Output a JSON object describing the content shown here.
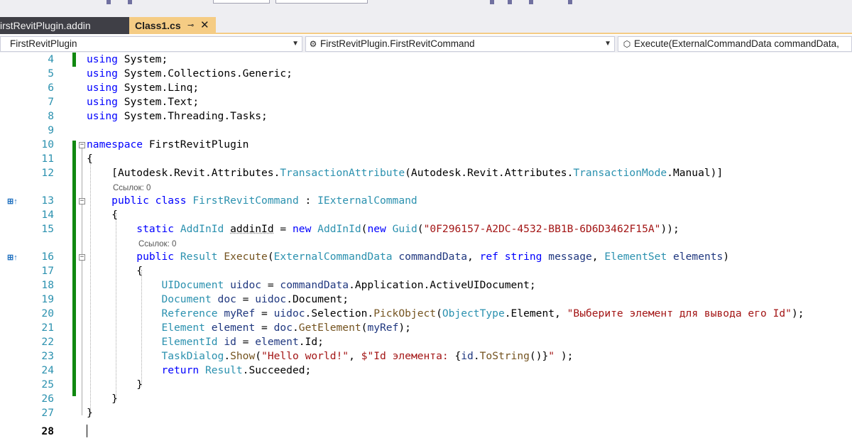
{
  "tabs": {
    "inactive_label": "irstRevitPlugin.addin",
    "active_label": "Class1.cs",
    "pin_icon": "⊸",
    "close_icon": "✕"
  },
  "nav": {
    "project": "FirstRevitPlugin",
    "class_icon": "⚙",
    "class": "FirstRevitPlugin.FirstRevitCommand",
    "member_icon": "⬡",
    "member": "Execute(ExternalCommandData commandData,"
  },
  "editor": {
    "references_0_label": "Ссылок: 0",
    "references_0_label_b": "Ссылок: 0",
    "reference_0_label": "Ссылок: 0",
    "current_line": "28",
    "gutter_icon": "⊞↑",
    "lines": [
      {
        "n": "4",
        "tokens": [
          [
            "kw",
            "using"
          ],
          [
            "",
            "System;"
          ]
        ]
      },
      {
        "n": "5",
        "tokens": [
          [
            "kw",
            "using"
          ],
          [
            "",
            "System.Collections.Generic;"
          ]
        ]
      },
      {
        "n": "6",
        "tokens": [
          [
            "kw",
            "using"
          ],
          [
            "",
            "System.Linq;"
          ]
        ]
      },
      {
        "n": "7",
        "tokens": [
          [
            "kw",
            "using"
          ],
          [
            "",
            "System.Text;"
          ]
        ]
      },
      {
        "n": "8",
        "tokens": [
          [
            "kw",
            "using"
          ],
          [
            "",
            "System.Threading.Tasks;"
          ]
        ]
      },
      {
        "n": "9",
        "tokens": []
      },
      {
        "n": "10",
        "tokens": [
          [
            "kw",
            "namespace"
          ],
          [
            "",
            "FirstRevitPlugin"
          ]
        ]
      },
      {
        "n": "11",
        "tokens": [
          [
            "",
            "{"
          ]
        ]
      },
      {
        "n": "12",
        "tokens": [
          [
            "",
            "    ["
          ],
          [
            "",
            "Autodesk.Revit.Attributes."
          ],
          [
            "ty",
            "TransactionAttribute"
          ],
          [
            "",
            "(Autodesk.Revit.Attributes."
          ],
          [
            "ty",
            "TransactionMode"
          ],
          [
            "",
            ".Manual)]"
          ]
        ]
      },
      {
        "n": "13",
        "tokens": [
          [
            "",
            "    "
          ],
          [
            "kw",
            "public class"
          ],
          [
            "ty",
            "FirstRevitCommand"
          ],
          [
            "",
            " : "
          ],
          [
            "ty",
            "IExternalCommand"
          ]
        ]
      },
      {
        "n": "14",
        "tokens": [
          [
            "",
            "    {"
          ]
        ]
      },
      {
        "n": "15",
        "tokens": [
          [
            "",
            "        "
          ],
          [
            "kw",
            "static"
          ],
          [
            "ty",
            "AddInId"
          ],
          [
            "sq",
            "addinId"
          ],
          [
            "",
            " = "
          ],
          [
            "kw",
            "new"
          ],
          [
            "ty",
            "AddInId"
          ],
          [
            "",
            "("
          ],
          [
            "kw",
            "new"
          ],
          [
            "ty",
            "Guid"
          ],
          [
            "",
            "("
          ],
          [
            "st",
            "\"0F296157-A2DC-4532-BB1B-6D6D3462F15A\""
          ],
          [
            "",
            "));"
          ]
        ]
      },
      {
        "n": "16",
        "tokens": [
          [
            "",
            "        "
          ],
          [
            "kw",
            "public"
          ],
          [
            "ty",
            "Result"
          ],
          [
            "mt",
            "Execute"
          ],
          [
            "",
            "("
          ],
          [
            "ty",
            "ExternalCommandData"
          ],
          [
            "pr",
            "commandData"
          ],
          [
            "",
            ", "
          ],
          [
            "kw",
            "ref string"
          ],
          [
            "pr",
            "message"
          ],
          [
            "",
            ", "
          ],
          [
            "ty",
            "ElementSet"
          ],
          [
            "pr",
            "elements"
          ],
          [
            "",
            ")"
          ]
        ]
      },
      {
        "n": "17",
        "tokens": [
          [
            "",
            "        {"
          ]
        ]
      },
      {
        "n": "18",
        "tokens": [
          [
            "",
            "            "
          ],
          [
            "ty",
            "UIDocument"
          ],
          [
            "pr",
            "uidoc"
          ],
          [
            "",
            " = "
          ],
          [
            "pr",
            "commandData"
          ],
          [
            "",
            ".Application.ActiveUIDocument;"
          ]
        ]
      },
      {
        "n": "19",
        "tokens": [
          [
            "",
            "            "
          ],
          [
            "ty",
            "Document"
          ],
          [
            "pr",
            "doc"
          ],
          [
            "",
            " = "
          ],
          [
            "pr",
            "uidoc"
          ],
          [
            "",
            ".Document;"
          ]
        ]
      },
      {
        "n": "20",
        "tokens": [
          [
            "",
            "            "
          ],
          [
            "ty",
            "Reference"
          ],
          [
            "pr",
            "myRef"
          ],
          [
            "",
            " = "
          ],
          [
            "pr",
            "uidoc"
          ],
          [
            "",
            ".Selection."
          ],
          [
            "mt",
            "PickObject"
          ],
          [
            "",
            "("
          ],
          [
            "ty",
            "ObjectType"
          ],
          [
            "",
            ".Element, "
          ],
          [
            "st",
            "\"Выберите элемент для вывода его Id\""
          ],
          [
            "",
            ");"
          ]
        ]
      },
      {
        "n": "21",
        "tokens": [
          [
            "",
            "            "
          ],
          [
            "ty",
            "Element"
          ],
          [
            "pr",
            "element"
          ],
          [
            "",
            " = "
          ],
          [
            "pr",
            "doc"
          ],
          [
            "",
            "."
          ],
          [
            "mt",
            "GetElement"
          ],
          [
            "",
            "("
          ],
          [
            "pr",
            "myRef"
          ],
          [
            "",
            ");"
          ]
        ]
      },
      {
        "n": "22",
        "tokens": [
          [
            "",
            "            "
          ],
          [
            "ty",
            "ElementId"
          ],
          [
            "pr",
            "id"
          ],
          [
            "",
            " = "
          ],
          [
            "pr",
            "element"
          ],
          [
            "",
            ".Id;"
          ]
        ]
      },
      {
        "n": "23",
        "tokens": [
          [
            "",
            "            "
          ],
          [
            "ty",
            "TaskDialog"
          ],
          [
            "",
            "."
          ],
          [
            "mt",
            "Show"
          ],
          [
            "",
            "("
          ],
          [
            "st",
            "\"Hello world!\""
          ],
          [
            "",
            ", "
          ],
          [
            "st",
            "$\"Id элемента: "
          ],
          [
            "",
            "{"
          ],
          [
            "pr",
            "id"
          ],
          [
            "",
            "."
          ],
          [
            "mt",
            "ToString"
          ],
          [
            "",
            "()}"
          ],
          [
            "st",
            "\""
          ],
          [
            "",
            " );"
          ]
        ]
      },
      {
        "n": "24",
        "tokens": [
          [
            "",
            "            "
          ],
          [
            "kw",
            "return"
          ],
          [
            "ty",
            "Result"
          ],
          [
            "",
            ".Succeeded;"
          ]
        ]
      },
      {
        "n": "25",
        "tokens": [
          [
            "",
            "        }"
          ]
        ]
      },
      {
        "n": "26",
        "tokens": [
          [
            "",
            "    }"
          ]
        ]
      },
      {
        "n": "27",
        "tokens": [
          [
            "",
            "}"
          ]
        ]
      },
      {
        "n": "28",
        "tokens": []
      }
    ]
  }
}
